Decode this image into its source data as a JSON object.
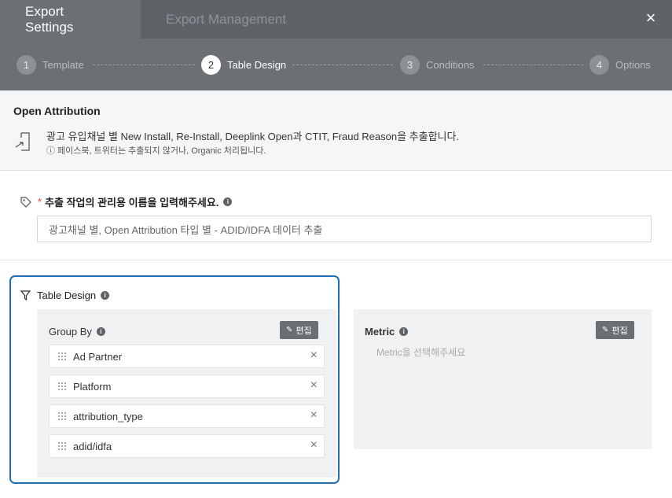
{
  "tabs": {
    "settings": "Export Settings",
    "management": "Export Management"
  },
  "close_symbol": "×",
  "steps": [
    {
      "num": "1",
      "label": "Template"
    },
    {
      "num": "2",
      "label": "Table Design"
    },
    {
      "num": "3",
      "label": "Conditions"
    },
    {
      "num": "4",
      "label": "Options"
    }
  ],
  "current_step": 2,
  "info": {
    "title": "Open Attribution",
    "description": "광고 유입채널 별 New Install, Re-Install, Deeplink Open과 CTIT, Fraud Reason을 추출합니다.",
    "note": "ⓘ 페이스북, 트위터는 추출되지 않거나, Organic 처리됩니다."
  },
  "name_field": {
    "required_mark": "*",
    "label": "추출 작업의 관리용 이름을 입력해주세요.",
    "value": "광고채널 별, Open Attribution 타입 별 - ADID/IDFA 데이터 추출"
  },
  "table_design": {
    "title": "Table Design",
    "group_by": {
      "title": "Group By",
      "edit_label": "편집",
      "items": [
        "Ad Partner",
        "Platform",
        "attribution_type",
        "adid/idfa"
      ]
    },
    "metric": {
      "title": "Metric",
      "edit_label": "편집",
      "placeholder": "Metric을 선택해주세요"
    }
  },
  "colors": {
    "header_bg": "#5f6368",
    "active_card_border": "#1f6fb2",
    "required": "#e53935"
  }
}
